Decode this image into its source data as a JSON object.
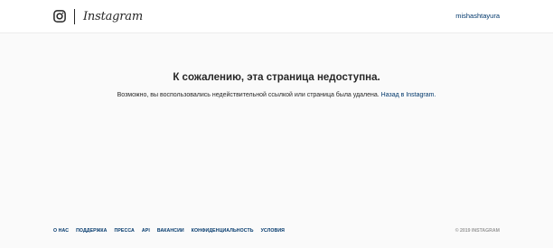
{
  "header": {
    "logo_icon": "instagram-camera-icon",
    "wordmark": "Instagram",
    "username": "mishashtayura"
  },
  "main": {
    "title": "К сожалению, эта страница недоступна.",
    "message": "Возможно, вы воспользовались недействительной ссылкой или страница была удалена. ",
    "back_link": "Назад в Instagram."
  },
  "footer": {
    "links": [
      "О НАС",
      "ПОДДЕРЖКА",
      "ПРЕССА",
      "API",
      "ВАКАНСИИ",
      "КОНФИДЕНЦИАЛЬНОСТЬ",
      "УСЛОВИЯ"
    ],
    "copyright": "© 2019 INSTAGRAM"
  },
  "colors": {
    "background": "#fafafa",
    "header_background": "#ffffff",
    "link": "#00376b",
    "text": "#262626",
    "muted": "#999999"
  }
}
